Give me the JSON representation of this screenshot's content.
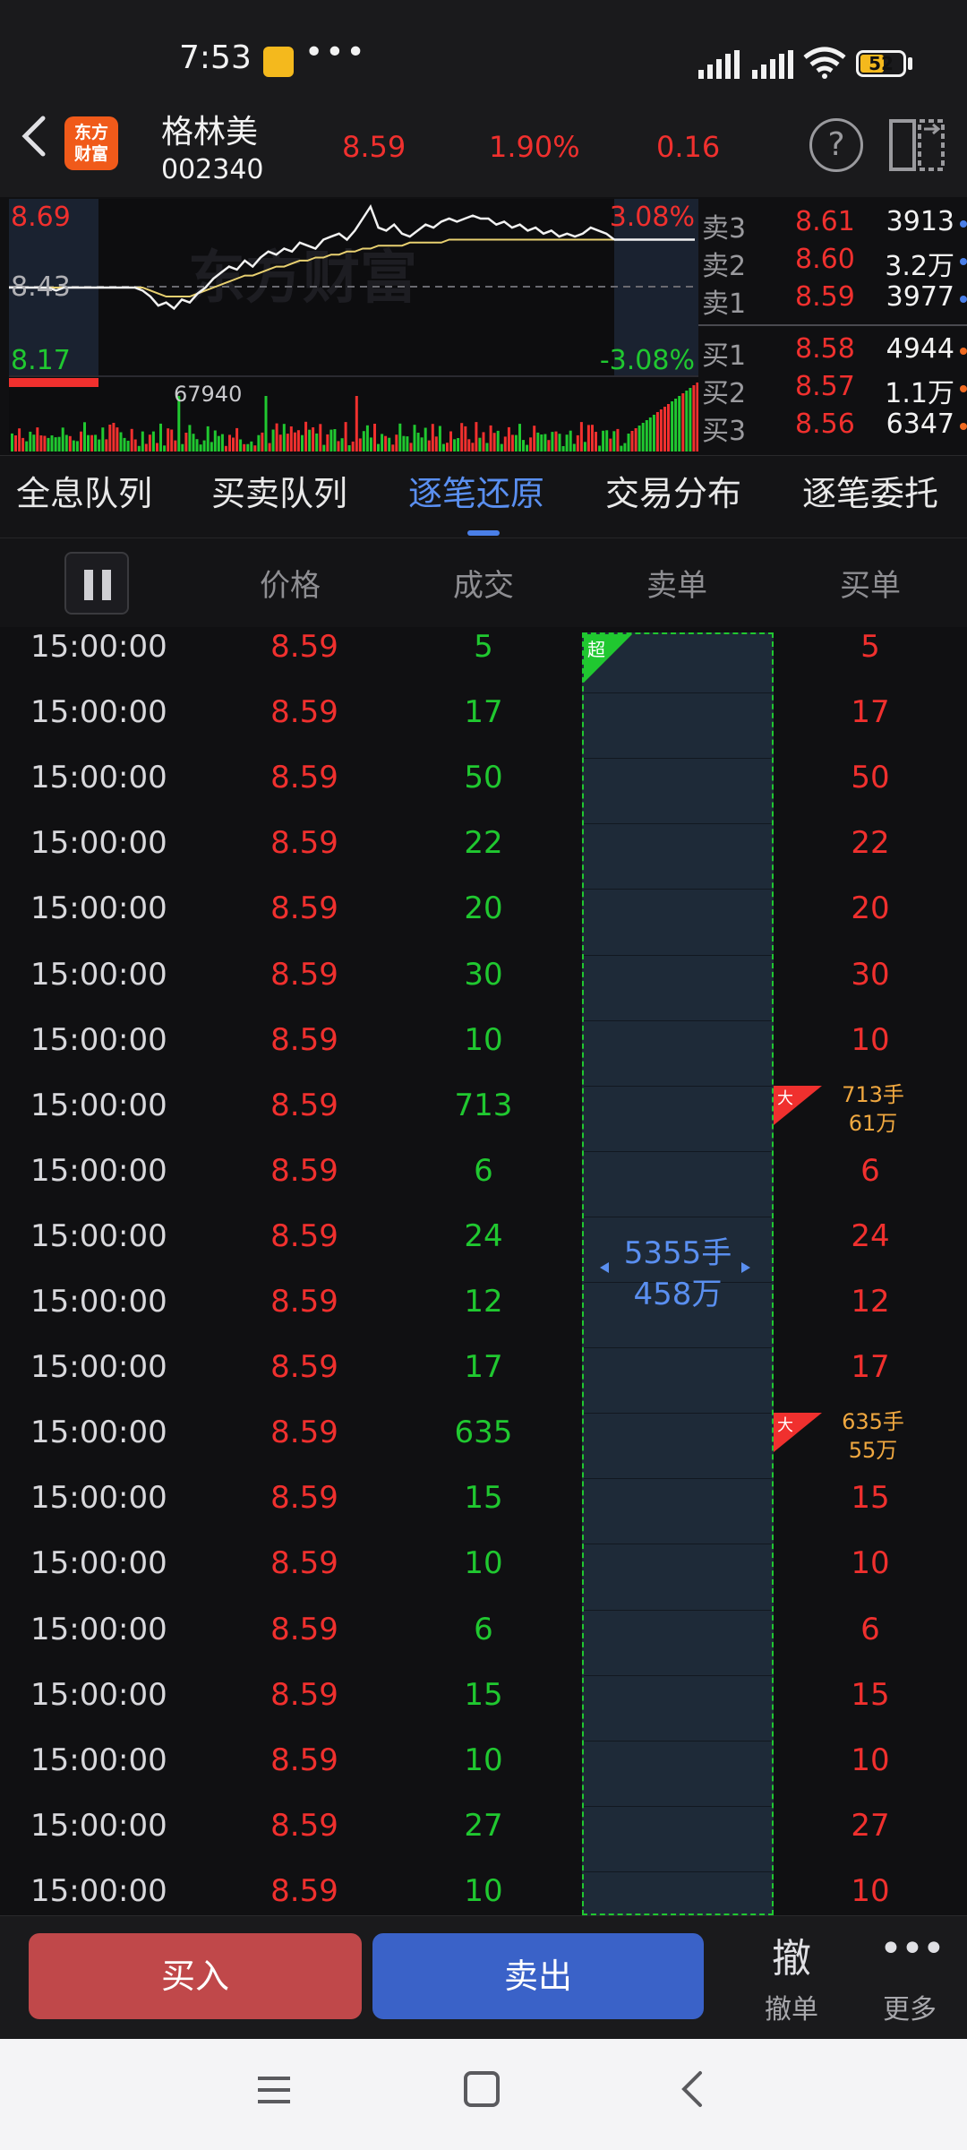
{
  "status": {
    "time": "7:53",
    "dots": "•••",
    "battery": "52"
  },
  "header": {
    "name": "格林美",
    "code": "002340",
    "price": "8.59",
    "pct": "1.90%",
    "change": "0.16",
    "logo_line1": "东方",
    "logo_line2": "财富",
    "help": "?"
  },
  "chart": {
    "high": "8.69",
    "low": "8.17",
    "prev_close": "8.43",
    "high_pct": "3.08%",
    "low_pct": "-3.08%",
    "volume_label": "67940",
    "watermark": "东方财富",
    "price_series": [
      8.43,
      8.43,
      8.43,
      8.43,
      8.43,
      8.43,
      8.42,
      8.43,
      8.43,
      8.43,
      8.43,
      8.43,
      8.43,
      8.43,
      8.43,
      8.43,
      8.43,
      8.42,
      8.4,
      8.37,
      8.38,
      8.36,
      8.39,
      8.38,
      8.41,
      8.43,
      8.46,
      8.48,
      8.5,
      8.49,
      8.52,
      8.5,
      8.53,
      8.55,
      8.54,
      8.56,
      8.55,
      8.58,
      8.57,
      8.56,
      8.59,
      8.6,
      8.61,
      8.59,
      8.62,
      8.66,
      8.7,
      8.63,
      8.62,
      8.64,
      8.61,
      8.6,
      8.62,
      8.64,
      8.63,
      8.65,
      8.66,
      8.65,
      8.66,
      8.67,
      8.66,
      8.66,
      8.64,
      8.65,
      8.63,
      8.64,
      8.62,
      8.63,
      8.61,
      8.62,
      8.6,
      8.61,
      8.6,
      8.61,
      8.63,
      8.62,
      8.61,
      8.59
    ],
    "avg_series": [
      8.43,
      8.43,
      8.43,
      8.43,
      8.43,
      8.43,
      8.43,
      8.43,
      8.43,
      8.43,
      8.43,
      8.43,
      8.43,
      8.43,
      8.43,
      8.43,
      8.43,
      8.43,
      8.42,
      8.41,
      8.4,
      8.4,
      8.4,
      8.4,
      8.41,
      8.42,
      8.43,
      8.44,
      8.45,
      8.46,
      8.47,
      8.47,
      8.48,
      8.49,
      8.5,
      8.5,
      8.51,
      8.52,
      8.52,
      8.53,
      8.53,
      8.54,
      8.54,
      8.55,
      8.55,
      8.56,
      8.56,
      8.57,
      8.57,
      8.57,
      8.57,
      8.58,
      8.58,
      8.58,
      8.58,
      8.58,
      8.59,
      8.59,
      8.59,
      8.59,
      8.59,
      8.59,
      8.59,
      8.59,
      8.59,
      8.59,
      8.59,
      8.59,
      8.59,
      8.59,
      8.59,
      8.59,
      8.59,
      8.59,
      8.59,
      8.59,
      8.59,
      8.59
    ]
  },
  "orderbook": {
    "asks": [
      {
        "label": "卖3",
        "price": "8.61",
        "vol": "3913"
      },
      {
        "label": "卖2",
        "price": "8.60",
        "vol": "3.2万"
      },
      {
        "label": "卖1",
        "price": "8.59",
        "vol": "3977"
      }
    ],
    "bids": [
      {
        "label": "买1",
        "price": "8.58",
        "vol": "4944"
      },
      {
        "label": "买2",
        "price": "8.57",
        "vol": "1.1万"
      },
      {
        "label": "买3",
        "price": "8.56",
        "vol": "6347"
      }
    ]
  },
  "tabs": [
    "全息队列",
    "买卖队列",
    "逐笔还原",
    "交易分布",
    "逐笔委托"
  ],
  "columns": {
    "price": "价格",
    "deal": "成交",
    "sell": "卖单",
    "buy": "买单"
  },
  "rows": [
    {
      "time": "15:00:00",
      "price": "8.59",
      "deal": "5",
      "buy": "5"
    },
    {
      "time": "15:00:00",
      "price": "8.59",
      "deal": "17",
      "buy": "17"
    },
    {
      "time": "15:00:00",
      "price": "8.59",
      "deal": "50",
      "buy": "50"
    },
    {
      "time": "15:00:00",
      "price": "8.59",
      "deal": "22",
      "buy": "22"
    },
    {
      "time": "15:00:00",
      "price": "8.59",
      "deal": "20",
      "buy": "20"
    },
    {
      "time": "15:00:00",
      "price": "8.59",
      "deal": "30",
      "buy": "30"
    },
    {
      "time": "15:00:00",
      "price": "8.59",
      "deal": "10",
      "buy": "10"
    },
    {
      "time": "15:00:00",
      "price": "8.59",
      "deal": "713",
      "buy_big1": "713手",
      "buy_big2": "61万",
      "big": true
    },
    {
      "time": "15:00:00",
      "price": "8.59",
      "deal": "6",
      "buy": "6"
    },
    {
      "time": "15:00:00",
      "price": "8.59",
      "deal": "24",
      "buy": "24"
    },
    {
      "time": "15:00:00",
      "price": "8.59",
      "deal": "12",
      "buy": "12"
    },
    {
      "time": "15:00:00",
      "price": "8.59",
      "deal": "17",
      "buy": "17"
    },
    {
      "time": "15:00:00",
      "price": "8.59",
      "deal": "635",
      "buy_big1": "635手",
      "buy_big2": "55万",
      "big": true
    },
    {
      "time": "15:00:00",
      "price": "8.59",
      "deal": "15",
      "buy": "15"
    },
    {
      "time": "15:00:00",
      "price": "8.59",
      "deal": "10",
      "buy": "10"
    },
    {
      "time": "15:00:00",
      "price": "8.59",
      "deal": "6",
      "buy": "6"
    },
    {
      "time": "15:00:00",
      "price": "8.59",
      "deal": "15",
      "buy": "15"
    },
    {
      "time": "15:00:00",
      "price": "8.59",
      "deal": "10",
      "buy": "10"
    },
    {
      "time": "15:00:00",
      "price": "8.59",
      "deal": "27",
      "buy": "27"
    },
    {
      "time": "15:00:00",
      "price": "8.59",
      "deal": "10",
      "buy": "10"
    }
  ],
  "sell_block": {
    "line1": "5355手",
    "line2": "458万",
    "super_tag": "超",
    "big_tag": "大"
  },
  "bottom": {
    "buy": "买入",
    "sell": "卖出",
    "cancel_icon": "撤",
    "cancel": "撤单",
    "more_icon": "•••",
    "more": "更多"
  },
  "colors": {
    "up": "#f0302e",
    "down": "#20c830",
    "accent": "#5a8ff0"
  }
}
